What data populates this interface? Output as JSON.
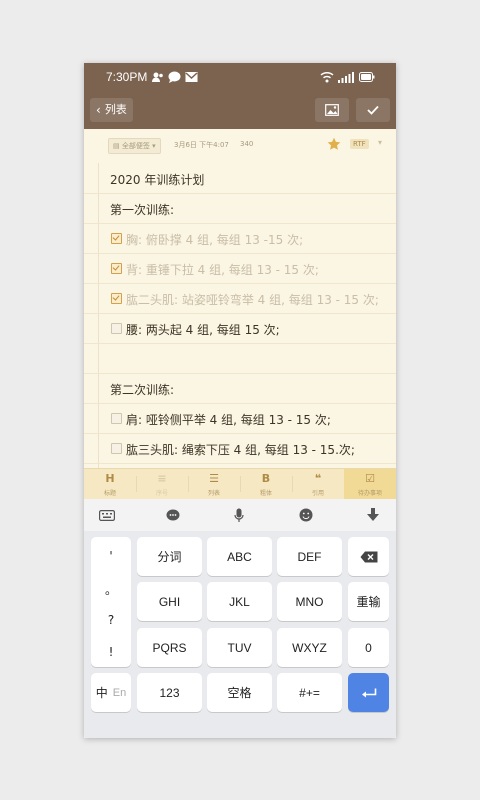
{
  "status": {
    "time": "7:30PM"
  },
  "nav": {
    "back_label": "列表"
  },
  "meta": {
    "folder": "全部便签",
    "date": "3月6日 下午4:07",
    "count": "340",
    "format": "RTF"
  },
  "note": {
    "title": "2020 年训练计划",
    "section1": "第一次训练:",
    "todos1": [
      {
        "text": "胸: 俯卧撑 4 组, 每组 13 -15 次;",
        "done": true
      },
      {
        "text": "背: 重锤下拉 4 组, 每组 13 - 15 次;",
        "done": true
      },
      {
        "text": "肱二头肌: 站姿哑铃弯举 4 组, 每组 13 - 15 次;",
        "done": true
      },
      {
        "text": "腰: 两头起 4 组, 每组 15 次;",
        "done": false
      }
    ],
    "section2": "第二次训练:",
    "todos2": [
      {
        "text": "肩: 哑铃侧平举 4 组, 每组 13 - 15 次;",
        "done": false
      },
      {
        "text": "肱三头肌: 绳索下压 4 组, 每组 13 - 15.次;",
        "done": false
      }
    ]
  },
  "toolbar": {
    "items": [
      {
        "icon": "H",
        "label": "标题"
      },
      {
        "icon": "≡",
        "label": "序号"
      },
      {
        "icon": "☰",
        "label": "列表"
      },
      {
        "icon": "B",
        "label": "粗体"
      },
      {
        "icon": "❝",
        "label": "引用"
      },
      {
        "icon": "☑",
        "label": "待办事项"
      }
    ]
  },
  "keyboard": {
    "punct": [
      "'",
      "。",
      "?",
      "!"
    ],
    "row1": [
      "分词",
      "ABC",
      "DEF"
    ],
    "row2": [
      "GHI",
      "JKL",
      "MNO"
    ],
    "row3": [
      "PQRS",
      "TUV",
      "WXYZ"
    ],
    "row4": [
      "123",
      "空格",
      "#+="
    ],
    "reinput": "重输",
    "zero": "0",
    "lang_zh": "中",
    "lang_en": "En"
  },
  "colors": {
    "header": "#7b6350",
    "accent": "#d1a24d",
    "enter": "#4f84e5"
  }
}
